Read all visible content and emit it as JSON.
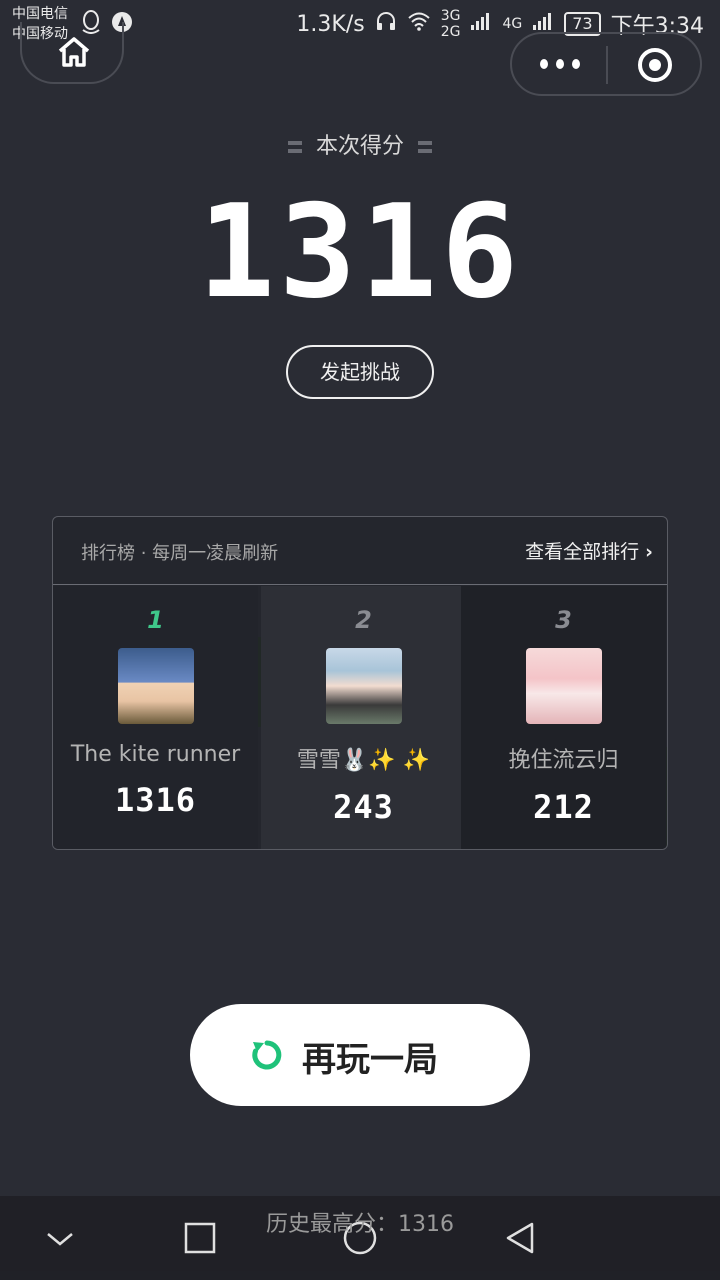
{
  "status_bar": {
    "carrier_1": "中国电信",
    "carrier_2": "中国移动",
    "speed": "1.3K/s",
    "network_1": "3G",
    "network_2": "2G",
    "network_3": "4G",
    "battery": "73",
    "time": "下午3:34"
  },
  "score": {
    "label": "本次得分",
    "value": "1316"
  },
  "challenge_button": "发起挑战",
  "ranking": {
    "title": "排行榜 · 每周一凌晨刷新",
    "view_all": "查看全部排行",
    "entries": [
      {
        "rank": "1",
        "name": "The kite runner",
        "score": "1316"
      },
      {
        "rank": "2",
        "name": "雪雪🐰✨ ✨",
        "score": "243"
      },
      {
        "rank": "3",
        "name": "挽住流云归",
        "score": "212"
      }
    ]
  },
  "replay_button": "再玩一局",
  "history_best": "历史最高分：1316",
  "colors": {
    "background": "#2a2c34",
    "accent": "#3fc88a"
  }
}
